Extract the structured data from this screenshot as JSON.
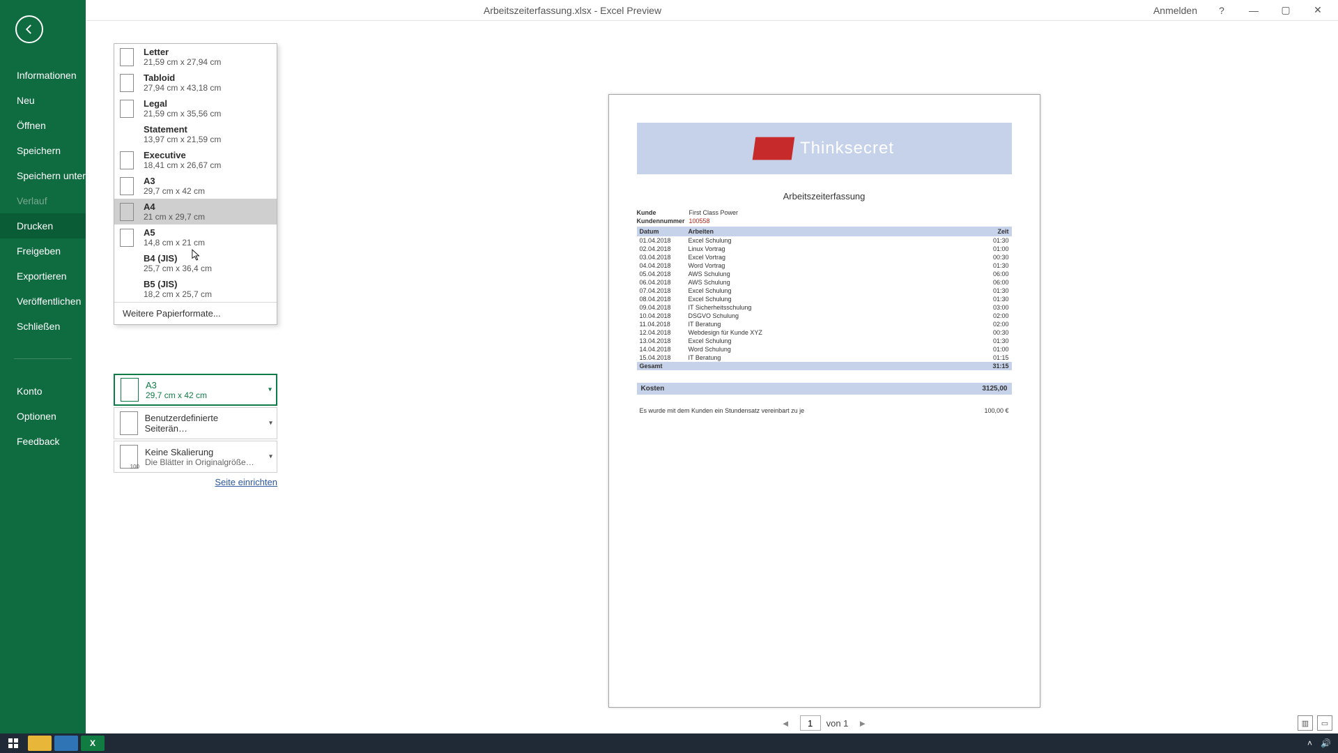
{
  "titlebar": {
    "title": "Arbeitszeiterfassung.xlsx  -  Excel Preview",
    "signin": "Anmelden",
    "help": "?"
  },
  "sidebar": {
    "items": [
      {
        "label": "Informationen"
      },
      {
        "label": "Neu"
      },
      {
        "label": "Öffnen"
      },
      {
        "label": "Speichern"
      },
      {
        "label": "Speichern unter"
      },
      {
        "label": "Verlauf",
        "disabled": true
      },
      {
        "label": "Drucken",
        "active": true
      },
      {
        "label": "Freigeben"
      },
      {
        "label": "Exportieren"
      },
      {
        "label": "Veröffentlichen"
      },
      {
        "label": "Schließen"
      }
    ],
    "lower": [
      {
        "label": "Konto"
      },
      {
        "label": "Optionen"
      },
      {
        "label": "Feedback"
      }
    ]
  },
  "paperSizes": [
    {
      "name": "Letter",
      "dim": "21,59 cm x 27,94 cm",
      "icon": true
    },
    {
      "name": "Tabloid",
      "dim": "27,94 cm x 43,18 cm",
      "icon": true
    },
    {
      "name": "Legal",
      "dim": "21,59 cm x 35,56 cm",
      "icon": true
    },
    {
      "name": "Statement",
      "dim": "13,97 cm x 21,59 cm",
      "icon": false
    },
    {
      "name": "Executive",
      "dim": "18,41 cm x 26,67 cm",
      "icon": true
    },
    {
      "name": "A3",
      "dim": "29,7 cm x 42 cm",
      "icon": true
    },
    {
      "name": "A4",
      "dim": "21 cm x 29,7 cm",
      "icon": true,
      "hover": true
    },
    {
      "name": "A5",
      "dim": "14,8 cm x 21 cm",
      "icon": true
    },
    {
      "name": "B4 (JIS)",
      "dim": "25,7 cm x 36,4 cm",
      "icon": false
    },
    {
      "name": "B5 (JIS)",
      "dim": "18,2 cm x 25,7 cm",
      "icon": false
    }
  ],
  "paperMore": "Weitere Papierformate...",
  "selected": {
    "paper": {
      "name": "A3",
      "dim": "29,7 cm x 42 cm"
    },
    "margins": {
      "name": "Benutzerdefinierte Seiterän…"
    },
    "scaling": {
      "name": "Keine Skalierung",
      "desc": "Die Blätter in Originalgröße…"
    }
  },
  "pageSetupLink": "Seite einrichten",
  "pager": {
    "current": "1",
    "of": "von 1"
  },
  "doc": {
    "brand": "Thinksecret",
    "title": "Arbeitszeiterfassung",
    "meta": {
      "kunde_label": "Kunde",
      "kunde": "First Class Power",
      "nr_label": "Kundennummer",
      "nr": "100558"
    },
    "headers": {
      "date": "Datum",
      "work": "Arbeiten",
      "time": "Zeit"
    },
    "rows": [
      {
        "d": "01.04.2018",
        "w": "Excel Schulung",
        "t": "01:30"
      },
      {
        "d": "02.04.2018",
        "w": "Linux Vortrag",
        "t": "01:00"
      },
      {
        "d": "03.04.2018",
        "w": "Excel Vortrag",
        "t": "00:30"
      },
      {
        "d": "04.04.2018",
        "w": "Word Vortrag",
        "t": "01:30"
      },
      {
        "d": "05.04.2018",
        "w": "AWS Schulung",
        "t": "06:00"
      },
      {
        "d": "06.04.2018",
        "w": "AWS Schulung",
        "t": "06:00"
      },
      {
        "d": "07.04.2018",
        "w": "Excel Schulung",
        "t": "01:30"
      },
      {
        "d": "08.04.2018",
        "w": "Excel Schulung",
        "t": "01:30"
      },
      {
        "d": "09.04.2018",
        "w": "IT Sicherheitsschulung",
        "t": "03:00"
      },
      {
        "d": "10.04.2018",
        "w": "DSGVO Schulung",
        "t": "02:00"
      },
      {
        "d": "11.04.2018",
        "w": "IT Beratung",
        "t": "02:00"
      },
      {
        "d": "12.04.2018",
        "w": "Webdesign für Kunde XYZ",
        "t": "00:30"
      },
      {
        "d": "13.04.2018",
        "w": "Excel Schulung",
        "t": "01:30"
      },
      {
        "d": "14.04.2018",
        "w": "Word Schulung",
        "t": "01:00"
      },
      {
        "d": "15.04.2018",
        "w": "IT Beratung",
        "t": "01:15"
      }
    ],
    "sum": {
      "label": "Gesamt",
      "value": "31:15"
    },
    "cost": {
      "label": "Kosten",
      "value": "3125,00"
    },
    "agreement": {
      "text": "Es wurde mit dem Kunden ein Stundensatz vereinbart zu je",
      "rate": "100,00 €"
    }
  }
}
